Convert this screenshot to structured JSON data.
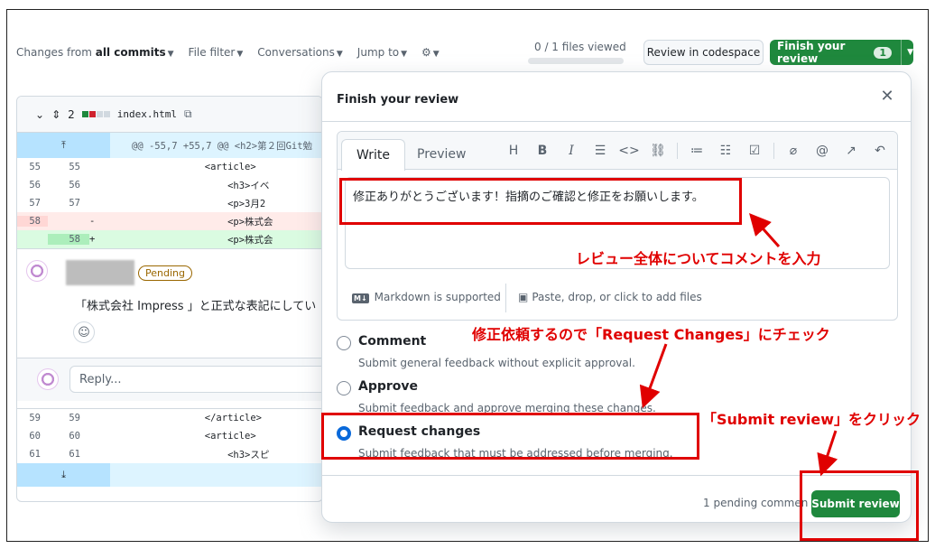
{
  "toolbar": {
    "changes_prefix": "Changes from",
    "changes_strong": "all commits",
    "file_filter": "File filter",
    "conversations": "Conversations",
    "jump_to": "Jump to",
    "files_viewed": "0 / 1 files viewed",
    "review_codespace": "Review in codespace",
    "finish_review": "Finish your review",
    "finish_count": "1"
  },
  "diff": {
    "file_count": "2",
    "file_name": "index.html",
    "hunk_header": "@@ -55,7 +55,7 @@ <h2>第２回Git勉",
    "rows": [
      {
        "old": "55",
        "new": "55",
        "sign": "",
        "code": "                  <article>"
      },
      {
        "old": "56",
        "new": "56",
        "sign": "",
        "code": "                      <h3>イベ"
      },
      {
        "old": "57",
        "new": "57",
        "sign": "",
        "code": "                      <p>3月2"
      },
      {
        "old": "58",
        "new": "",
        "sign": "-",
        "code": "                      <p>株式会"
      },
      {
        "old": "",
        "new": "58",
        "sign": "+",
        "code": "                      <p>株式会"
      }
    ],
    "rows_after": [
      {
        "old": "59",
        "new": "59",
        "sign": "",
        "code": "                  </article>"
      },
      {
        "old": "60",
        "new": "60",
        "sign": "",
        "code": "                  <article>"
      },
      {
        "old": "61",
        "new": "61",
        "sign": "",
        "code": "                      <h3>スピ"
      }
    ],
    "pending_badge": "Pending",
    "comment_text": "「株式会社 Impress 」と正式な表記にしてい",
    "reply_placeholder": "Reply..."
  },
  "modal": {
    "title": "Finish your review",
    "tab_write": "Write",
    "tab_preview": "Preview",
    "body_text": "修正ありがとうございます！指摘のご確認と修正をお願いします。",
    "markdown_note": "Markdown is supported",
    "attach_note": "Paste, drop, or click to add files",
    "options": [
      {
        "label": "Comment",
        "desc": "Submit general feedback without explicit approval.",
        "checked": false
      },
      {
        "label": "Approve",
        "desc": "Submit feedback and approve merging these changes.",
        "checked": false
      },
      {
        "label": "Request changes",
        "desc": "Submit feedback that must be addressed before merging.",
        "checked": true
      }
    ],
    "pending_comments": "1 pending commen",
    "submit_label": "Submit review"
  },
  "annotations": {
    "overall_comment": "レビュー全体についてコメントを入力",
    "request_changes": "修正依頼するので「Request Changes」にチェック",
    "click_submit": "「Submit review」をクリック"
  },
  "colors": {
    "primary_green": "#1f883d",
    "annotation_red": "#e00000",
    "radio_blue": "#0969da"
  }
}
